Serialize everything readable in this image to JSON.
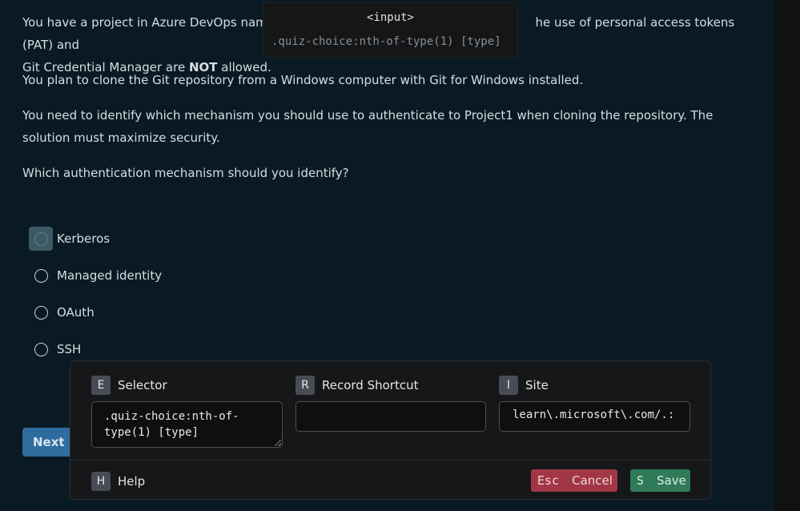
{
  "question": {
    "p1_before": "You have a project in Azure DevOps named",
    "p1_after": "he use of personal access tokens (PAT) and",
    "p1_line2_a": "Git Credential Manager are ",
    "p1_not": "NOT",
    "p1_line2_b": " allowed.",
    "p2": "You plan to clone the Git repository from a Windows computer with Git for Windows installed.",
    "p3": "You need to identify which mechanism you should use to authenticate to Project1 when cloning the repository. The solution must maximize security.",
    "p4": "Which authentication mechanism should you identify?"
  },
  "choices": [
    "Kerberos",
    "Managed identity",
    "OAuth",
    "SSH"
  ],
  "next_label": "Next",
  "next_arrow": "›",
  "tooltip": {
    "tag": "<input>",
    "selector": ".quiz-choice:nth-of-type(1) [type]"
  },
  "panel": {
    "selector": {
      "key": "E",
      "title": "Selector",
      "value": ".quiz-choice:nth-of-type(1) [type]"
    },
    "record": {
      "key": "R",
      "title": "Record Shortcut",
      "value": ""
    },
    "site": {
      "key": "I",
      "title": "Site",
      "value": "learn\\.microsoft\\.com/.:"
    },
    "help": {
      "key": "H",
      "label": "Help"
    },
    "cancel": {
      "key": "Esc",
      "label": "Cancel"
    },
    "save": {
      "key": "S",
      "label": "Save"
    }
  },
  "colors": {
    "page_bg": "#0a1a24",
    "next_button": "#2f6c9e",
    "cancel_button": "#a23646",
    "save_button": "#2f7a58",
    "focus_highlight": "#3a5a66"
  }
}
